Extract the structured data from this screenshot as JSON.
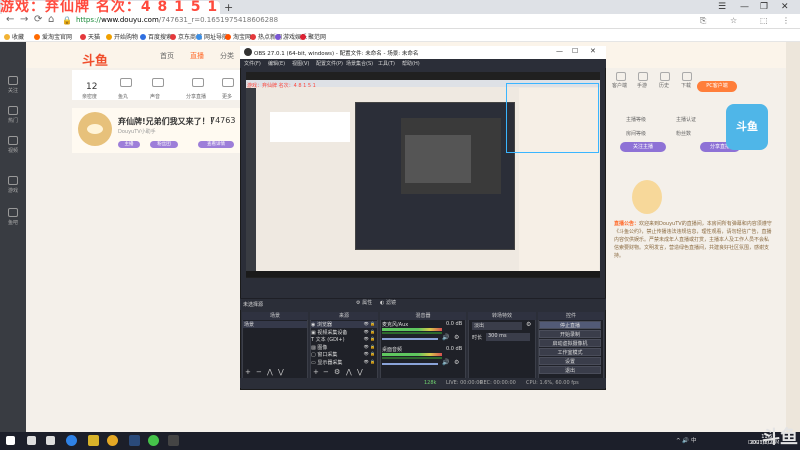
{
  "overlay": {
    "title": "游戏：弃仙牌    名次：4 8 1 5 1"
  },
  "browser": {
    "tab_title": "斗鱼-每个人的直播平台",
    "url_scheme": "https://",
    "url_domain": "www.douyu.com",
    "url_path": "/747631_r=0.1651975418606288",
    "win_controls": [
      "☰",
      "—",
      "❐",
      "✕"
    ],
    "bookmarks": [
      {
        "label": "收藏",
        "color": "#f2b233"
      },
      {
        "label": "爱淘宝官网",
        "color": "#ff6a00"
      },
      {
        "label": "天猫",
        "color": "#e4393c"
      },
      {
        "label": "开始购物",
        "color": "#f0a000"
      },
      {
        "label": "百度搜索",
        "color": "#2f6fe0"
      },
      {
        "label": "京东商城",
        "color": "#e4393c"
      },
      {
        "label": "网址导航",
        "color": "#3a8ee6"
      },
      {
        "label": "淘宝网",
        "color": "#ff5000"
      },
      {
        "label": "热点新闻",
        "color": "#e4393c"
      },
      {
        "label": "游戏娱乐",
        "color": "#7a56d6"
      },
      {
        "label": "聚范网",
        "color": "#d23"
      }
    ]
  },
  "douyu": {
    "logo": "斗鱼",
    "nav": [
      "首页",
      "直播",
      "分类"
    ],
    "left_nav": [
      "关注",
      "热门",
      "视频",
      "游戏",
      "鱼吧"
    ],
    "room_icons": [
      {
        "num": "12",
        "label": "亲密度"
      },
      {
        "num": "",
        "label": "鱼丸"
      },
      {
        "num": "",
        "label": "声音"
      },
      {
        "num": "",
        "label": "分享直播"
      },
      {
        "num": "",
        "label": "更多"
      }
    ],
    "room_title": "弃仙牌!兄弟们我又来了！！",
    "room_id": "74763",
    "room_sub": "DouyuTV小助手",
    "pills": [
      "主播",
      "粉丝团",
      "查看详情"
    ],
    "right_icons": [
      "客户端",
      "手游",
      "历史",
      "下载"
    ],
    "pc_button": "PC客户端",
    "right_lines": [
      "主播等级",
      "主播认证",
      "房间等级",
      "粉丝数"
    ],
    "purple_buttons": [
      "关注主播",
      "分享直播"
    ],
    "notice_title": "直播公告：",
    "notice": "欢迎来到DouyuTV的直播间，本房间所有弹幕和内容须遵守《斗鱼公约》，禁止传播违法违规信息，理性观看，请勿轻信广告，直播内容仅供娱乐。严禁未成年人直播或打赏，主播本人及工作人员不会私信索要财物。文明发言，营造绿色直播间，共建良好社区氛围，感谢支持。",
    "mascot_badge": "斗鱼"
  },
  "obs": {
    "title": "OBS 27.0.1 (64-bit, windows) - 配置文件: 未命名 - 场景: 未命名",
    "win_controls": [
      "—",
      "☐",
      "✕"
    ],
    "menu": [
      "文件(F)",
      "编辑(E)",
      "视图(V)",
      "配置文件(P)",
      "场景集合(S)",
      "工具(T)",
      "帮助(H)"
    ],
    "scene_bar_label": "未选择源",
    "scene_buttons": [
      "属性",
      "滤镜"
    ],
    "docks": {
      "scenes": "场景",
      "sources": "来源",
      "mixer": "混音器",
      "transitions": "转场特效",
      "controls": "控件"
    },
    "scenes": [
      "场景"
    ],
    "sources": [
      "浏览器",
      "视频采集设备",
      "文本 (GDI+)",
      "图像",
      "窗口采集",
      "显示器采集"
    ],
    "mixer": [
      {
        "name": "麦克风/Aux",
        "db": "0.0 dB"
      },
      {
        "name": "桌面音频",
        "db": "0.0 dB"
      }
    ],
    "transition": {
      "type": "淡出",
      "duration_label": "时长",
      "duration": "300 ms"
    },
    "controls": [
      "停止直播",
      "开始录制",
      "启动虚拟摄像机",
      "工作室模式",
      "设置",
      "退出"
    ],
    "status": {
      "live": "LIVE: 00:00:00",
      "rec": "REC: 00:00:00",
      "cpu": "CPU: 1.6%, 60.00 fps",
      "dropped": "128k"
    },
    "preview_red": "游戏：弃仙牌  名次：4 8 1 5 1"
  },
  "taskbar": {
    "apps": [
      {
        "name": "start",
        "color": "#ffffff"
      },
      {
        "name": "search",
        "color": "#dddddd"
      },
      {
        "name": "taskview",
        "color": "#dddddd"
      },
      {
        "name": "edge",
        "color": "#2f82e6"
      },
      {
        "name": "game",
        "color": "#d8b32a"
      },
      {
        "name": "chrome",
        "color": "#e4a825"
      },
      {
        "name": "steam",
        "color": "#2a4a7a"
      },
      {
        "name": "wechat",
        "color": "#45c34a"
      },
      {
        "name": "obs",
        "color": "#444444"
      }
    ],
    "tray": "^  🔊  中",
    "time": "11:52",
    "date": "2021/8/28"
  },
  "watermark": {
    "logo": "斗鱼",
    "site": "DOUYU.COM"
  }
}
